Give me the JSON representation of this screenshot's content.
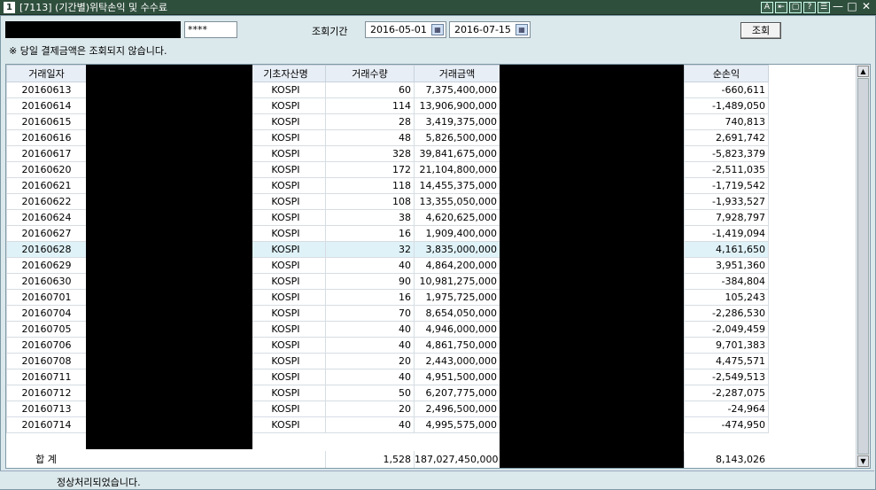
{
  "window": {
    "number": "1",
    "title": "[7113] (기간별)위탁손익 및 수수료",
    "buttons": [
      "A",
      "⇤",
      "▢",
      "?",
      "☰",
      "—",
      "□",
      "✕"
    ]
  },
  "query": {
    "account_mask": "****",
    "period_label": "조회기간",
    "start_date": "2016-05-01",
    "end_date": "2016-07-15",
    "button_label": "조회",
    "note": "※ 당일 결제금액은 조회되지 않습니다."
  },
  "table": {
    "headers": {
      "date": "거래일자",
      "underlying": "기초자산명",
      "qty": "거래수량",
      "amount": "거래금액",
      "pnl": "순손익"
    },
    "rows": [
      [
        "20160613",
        "KOSPI",
        "60",
        "7,375,400,000",
        "-660,611"
      ],
      [
        "20160614",
        "KOSPI",
        "114",
        "13,906,900,000",
        "-1,489,050"
      ],
      [
        "20160615",
        "KOSPI",
        "28",
        "3,419,375,000",
        "740,813"
      ],
      [
        "20160616",
        "KOSPI",
        "48",
        "5,826,500,000",
        "2,691,742"
      ],
      [
        "20160617",
        "KOSPI",
        "328",
        "39,841,675,000",
        "-5,823,379"
      ],
      [
        "20160620",
        "KOSPI",
        "172",
        "21,104,800,000",
        "-2,511,035"
      ],
      [
        "20160621",
        "KOSPI",
        "118",
        "14,455,375,000",
        "-1,719,542"
      ],
      [
        "20160622",
        "KOSPI",
        "108",
        "13,355,050,000",
        "-1,933,527"
      ],
      [
        "20160624",
        "KOSPI",
        "38",
        "4,620,625,000",
        "7,928,797"
      ],
      [
        "20160627",
        "KOSPI",
        "16",
        "1,909,400,000",
        "-1,419,094"
      ],
      [
        "20160628",
        "KOSPI",
        "32",
        "3,835,000,000",
        "4,161,650"
      ],
      [
        "20160629",
        "KOSPI",
        "40",
        "4,864,200,000",
        "3,951,360"
      ],
      [
        "20160630",
        "KOSPI",
        "90",
        "10,981,275,000",
        "-384,804"
      ],
      [
        "20160701",
        "KOSPI",
        "16",
        "1,975,725,000",
        "105,243"
      ],
      [
        "20160704",
        "KOSPI",
        "70",
        "8,654,050,000",
        "-2,286,530"
      ],
      [
        "20160705",
        "KOSPI",
        "40",
        "4,946,000,000",
        "-2,049,459"
      ],
      [
        "20160706",
        "KOSPI",
        "40",
        "4,861,750,000",
        "9,701,383"
      ],
      [
        "20160708",
        "KOSPI",
        "20",
        "2,443,000,000",
        "4,475,571"
      ],
      [
        "20160711",
        "KOSPI",
        "40",
        "4,951,500,000",
        "-2,549,513"
      ],
      [
        "20160712",
        "KOSPI",
        "50",
        "6,207,775,000",
        "-2,287,075"
      ],
      [
        "20160713",
        "KOSPI",
        "20",
        "2,496,500,000",
        "-24,964"
      ],
      [
        "20160714",
        "KOSPI",
        "40",
        "4,995,575,000",
        "-474,950"
      ]
    ],
    "selected_row": 10,
    "total": {
      "label": "합  계",
      "qty": "1,528",
      "amount": "187,027,450,000",
      "pnl": "8,143,026"
    }
  },
  "status_text": "정상처리되었습니다.",
  "colors": {
    "titlebar": "#2f4f3d",
    "panel": "#dbe8ec",
    "header": "#e8eef6",
    "selected_row": "#dff2f8"
  }
}
